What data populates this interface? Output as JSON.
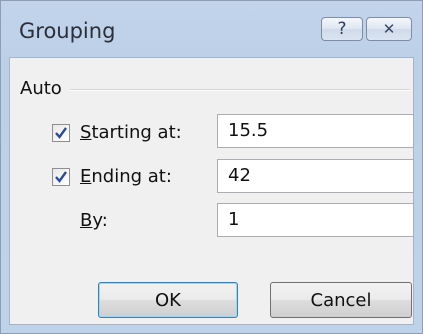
{
  "window": {
    "title": "Grouping",
    "help_glyph": "?",
    "close_glyph": "✕"
  },
  "group": {
    "label": "Auto"
  },
  "rows": {
    "start": {
      "label_first": "S",
      "label_rest": "tarting at:",
      "checked": true,
      "value": "15.5"
    },
    "end": {
      "label_first": "E",
      "label_rest": "nding at:",
      "checked": true,
      "value": "42"
    },
    "by": {
      "label_first": "B",
      "label_rest": "y:",
      "value": "1"
    }
  },
  "buttons": {
    "ok": "OK",
    "cancel": "Cancel"
  }
}
